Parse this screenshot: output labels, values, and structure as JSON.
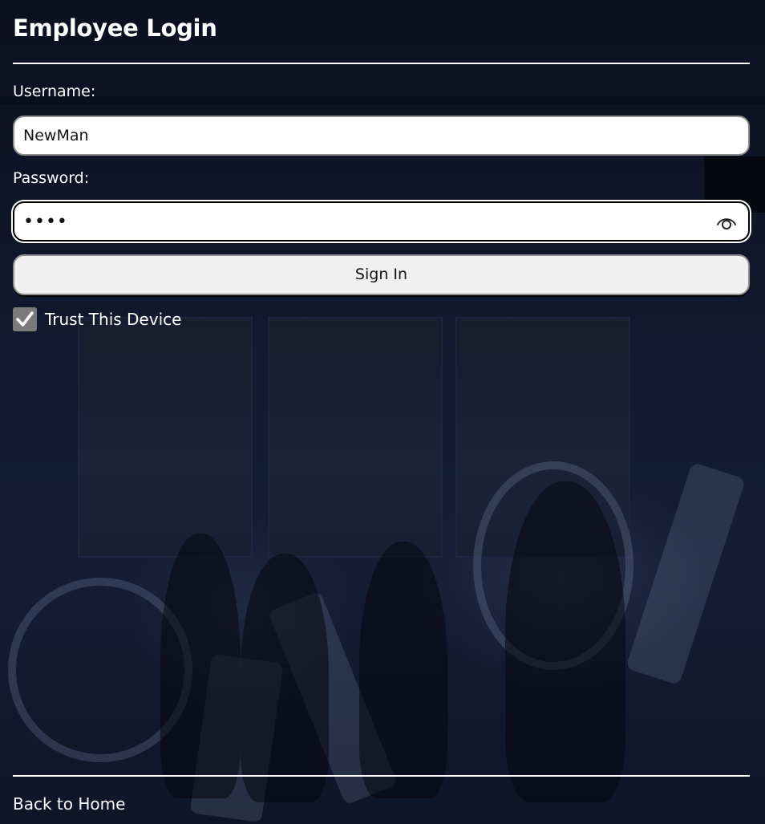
{
  "page": {
    "title": "Employee Login"
  },
  "form": {
    "username_label": "Username:",
    "username_value": "NewMan",
    "password_label": "Password:",
    "password_value": "••••",
    "password_toggle_icon": "eye-icon",
    "signin_label": "Sign In",
    "trust_label": "Trust This Device",
    "trust_checked": true
  },
  "footer": {
    "back_label": "Back to Home"
  },
  "colors": {
    "background": "#0c1223",
    "text": "#ffffff",
    "checkbox_fill": "#7a7a7a",
    "button_fill": "#f0f0f0"
  }
}
